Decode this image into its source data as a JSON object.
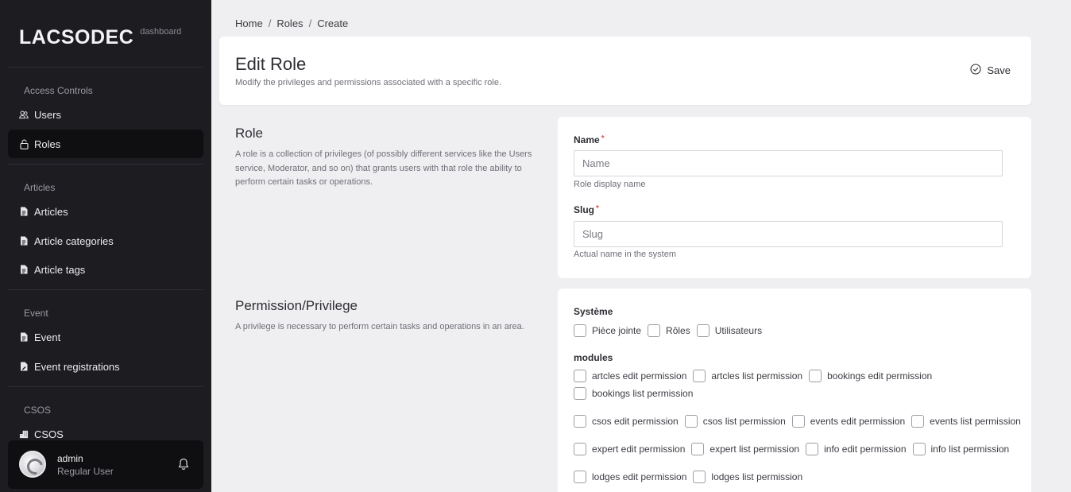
{
  "brand": {
    "name": "LACSODEC",
    "sub": "dashboard"
  },
  "sidebar": {
    "sections": [
      {
        "label": "Access Controls",
        "items": [
          {
            "label": "Users",
            "icon": "users-icon"
          },
          {
            "label": "Roles",
            "icon": "lock-icon",
            "active": true
          }
        ]
      },
      {
        "label": "Articles",
        "items": [
          {
            "label": "Articles",
            "icon": "document-icon"
          },
          {
            "label": "Article categories",
            "icon": "document-icon"
          },
          {
            "label": "Article tags",
            "icon": "document-icon"
          }
        ]
      },
      {
        "label": "Event",
        "items": [
          {
            "label": "Event",
            "icon": "document-icon"
          },
          {
            "label": "Event registrations",
            "icon": "document-edit-icon"
          }
        ]
      },
      {
        "label": "CSOS",
        "items": [
          {
            "label": "CSOS",
            "icon": "building-icon"
          }
        ]
      }
    ]
  },
  "user": {
    "name": "admin",
    "role": "Regular User"
  },
  "breadcrumb": [
    "Home",
    "Roles",
    "Create"
  ],
  "header": {
    "title": "Edit Role",
    "subtitle": "Modify the privileges and permissions associated with a specific role.",
    "save_label": "Save"
  },
  "role_section": {
    "title": "Role",
    "description": "A role is a collection of privileges (of possibly different services like the Users service, Moderator, and so on) that grants users with that role the ability to perform certain tasks or operations.",
    "name_label": "Name",
    "name_placeholder": "Name",
    "name_help": "Role display name",
    "slug_label": "Slug",
    "slug_placeholder": "Slug",
    "slug_help": "Actual name in the system",
    "required_mark": "*"
  },
  "permission_section": {
    "title": "Permission/Privilege",
    "description": "A privilege is necessary to perform certain tasks and operations in an area.",
    "groups": [
      {
        "label": "Système",
        "rows": [
          [
            "Pièce jointe",
            "Rôles",
            "Utilisateurs"
          ]
        ]
      },
      {
        "label": "modules",
        "rows": [
          [
            "artcles edit permission",
            "artcles list permission",
            "bookings edit permission"
          ],
          [
            "bookings list permission"
          ],
          [
            "csos edit permission",
            "csos list permission",
            "events edit permission",
            "events list permission"
          ],
          [
            "expert edit permission",
            "expert list permission",
            "info edit permission",
            "info list permission"
          ],
          [
            "lodges edit permission",
            "lodges list permission"
          ]
        ]
      }
    ]
  },
  "colors": {
    "sidebar_bg": "#1c1c21",
    "active_item_bg": "#0f0f12",
    "page_bg": "#efeff1",
    "required": "#d9534f"
  }
}
